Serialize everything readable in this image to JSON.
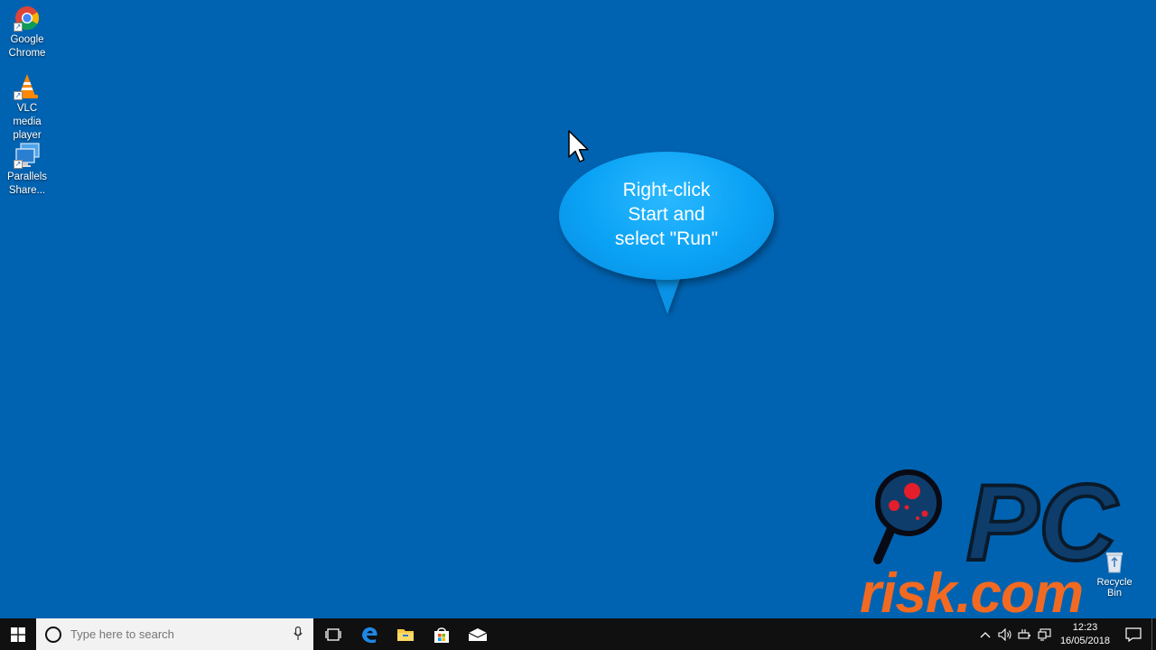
{
  "desktop": {
    "icons": [
      {
        "label": "Google\nChrome",
        "icon": "chrome-icon"
      },
      {
        "label": "VLC media\nplayer",
        "icon": "vlc-icon"
      },
      {
        "label": "Parallels\nShare...",
        "icon": "parallels-icon"
      }
    ],
    "recycle_bin": {
      "label": "Recycle Bin",
      "icon": "recycle-bin-icon"
    }
  },
  "callout": {
    "text": "Right-click\nStart and\nselect \"Run\""
  },
  "watermark": {
    "brand_top": "PC",
    "brand_bottom": "risk.com"
  },
  "taskbar": {
    "search_placeholder": "Type here to search",
    "clock_time": "12:23",
    "clock_date": "16/05/2018"
  },
  "colors": {
    "desktop": "#0063B1",
    "callout": "#0AA2F5",
    "taskbar": "#101010",
    "brand_orange": "#F26A21"
  }
}
